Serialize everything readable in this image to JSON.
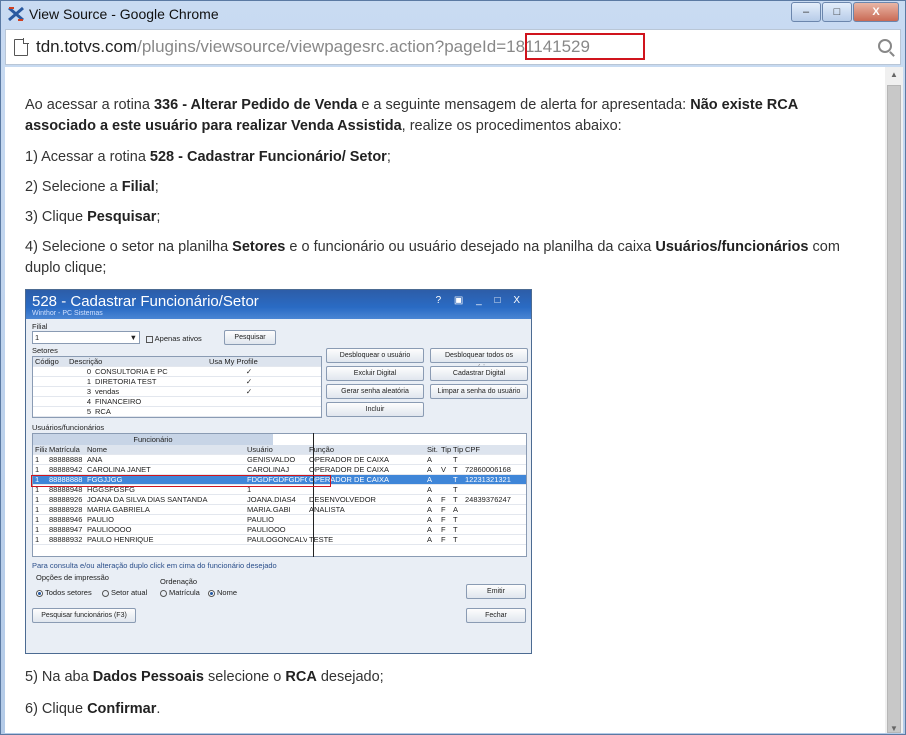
{
  "window": {
    "title": "View Source - Google Chrome",
    "controls": [
      "–",
      "□",
      "X"
    ]
  },
  "address": {
    "host": "tdn.totvs.com",
    "path": "/plugins/viewsource/viewpagesrc.action?pageId=",
    "page_id": "181141529"
  },
  "article": {
    "p1_pre": "Ao acessar a rotina ",
    "p1_b1": "336 - Alterar Pedido de Venda",
    "p1_mid": " e a seguinte  mensagem de alerta for apresentada: ",
    "p1_b2": "Não existe RCA",
    "p1_b3": "associado a este usuário para realizar Venda Assistida",
    "p1_post": ", realize os procedimentos abaixo:",
    "s1_pre": "1) Acessar a rotina ",
    "s1_b": "528 - Cadastrar Funcionário/ Setor",
    "s1_post": ";",
    "s2_pre": "2) Selecione a ",
    "s2_b": "Filial",
    "s2_post": ";",
    "s3_pre": "3) Clique ",
    "s3_b": "Pesquisar",
    "s3_post": ";",
    "s4_pre": "4) Selecione o setor na planilha ",
    "s4_b1": "Setores",
    "s4_mid": " e o funcionário ou usuário desejado na planilha da caixa ",
    "s4_b2": "Usuários/funcionários",
    "s4_post1": " com",
    "s4_post2": "duplo clique;",
    "s5_pre": "5) Na aba ",
    "s5_b1": "Dados Pessoais",
    "s5_mid": " selecione o ",
    "s5_b2": "RCA",
    "s5_post": " desejado;",
    "s6_pre": "6) Clique ",
    "s6_b": "Confirmar",
    "s6_post": "."
  },
  "screenshot": {
    "title": "528 - Cadastrar Funcionário/Setor",
    "subtitle": "Winthor - PC Sistemas",
    "controls": "? ▣ _ □ X",
    "filial_label": "Filial",
    "filial_value": "1",
    "apenas_ativos": "Apenas ativos",
    "pesquisar": "Pesquisar",
    "setores_label": "Setores",
    "setores_headers": [
      "Código",
      "Descrição",
      "Usa My Profile"
    ],
    "setores_rows": [
      [
        "0",
        "CONSULTORIA E PC",
        "✓"
      ],
      [
        "1",
        "DIRETORIA TEST",
        "✓"
      ],
      [
        "3",
        "vendas",
        "✓"
      ],
      [
        "4",
        "FINANCEIRO",
        ""
      ],
      [
        "5",
        "RCA",
        ""
      ]
    ],
    "buttons_left": [
      "Desbloquear o usuário",
      "Excluir Digital",
      "Gerar senha aleatória",
      "Incluir"
    ],
    "buttons_right": [
      "Desbloquear todos os usuários",
      "Cadastrar Digital",
      "Limpar a senha do usuário"
    ],
    "usuarios_label": "Usuários/funcionários",
    "band_label": "Funcionário",
    "grid_headers": [
      "Filial",
      "Matrícula",
      "Nome",
      "Usuário",
      "Função",
      "Sit.",
      "Tip",
      "Tip",
      "CPF"
    ],
    "grid_rows": [
      [
        "1",
        "88888888",
        "ANA",
        "GENISVALDO",
        "OPERADOR DE CAIXA",
        "A",
        "",
        "T",
        ""
      ],
      [
        "1",
        "88888942",
        "CAROLINA JANET",
        "CAROLINAJ",
        "OPERADOR DE CAIXA",
        "A",
        "V",
        "T",
        "72860006168"
      ],
      [
        "1",
        "88888888",
        "FGGJJGG",
        "FDGDFGDFGDFG",
        "OPERADOR DE CAIXA",
        "A",
        "",
        "T",
        "12231321321"
      ],
      [
        "1",
        "88888948",
        "HGGSFGSFG",
        "1",
        "",
        "A",
        "",
        "T",
        ""
      ],
      [
        "1",
        "88888926",
        "JOANA DA SILVA DIAS SANTANDA",
        "JOANA.DIAS4",
        "DESENVOLVEDOR",
        "A",
        "F",
        "T",
        "24839376247"
      ],
      [
        "1",
        "88888928",
        "MARIA GABRIELA",
        "MARIA.GABI",
        "ANALISTA",
        "A",
        "F",
        "A",
        ""
      ],
      [
        "1",
        "88888946",
        "PAULIO",
        "PAULIO",
        "",
        "A",
        "F",
        "T",
        ""
      ],
      [
        "1",
        "88888947",
        "PAULIOOOO",
        "PAULIOOO",
        "",
        "A",
        "F",
        "T",
        ""
      ],
      [
        "1",
        "88888932",
        "PAULO HENRIQUE",
        "PAULOGONCALVES",
        "TESTE",
        "A",
        "F",
        "T",
        ""
      ]
    ],
    "hint": "Para consulta e/ou alteração duplo click em cima do funcionário desejado",
    "opcoes_label": "Opções de impressão",
    "todos_setores": "Todos setores",
    "setor_atual": "Setor atual",
    "ordenacao_label": "Ordenação",
    "matricula": "Matrícula",
    "nome": "Nome",
    "emitir": "Emitir",
    "pesquisar_func": "Pesquisar funcionários (F3)",
    "fechar": "Fechar"
  }
}
